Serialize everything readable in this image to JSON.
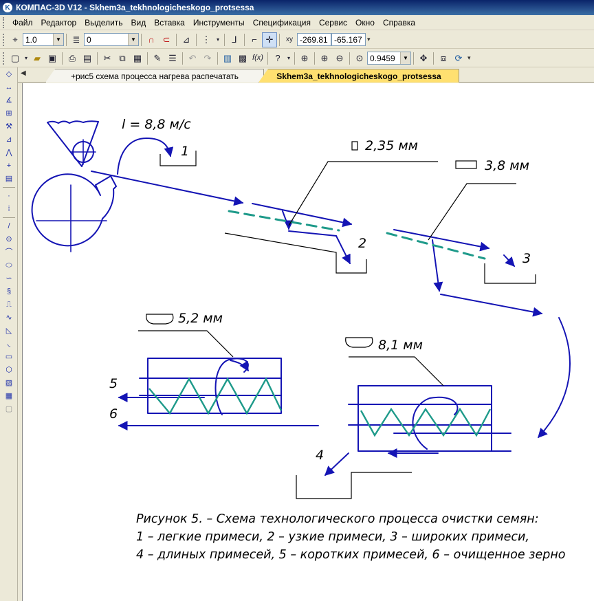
{
  "window": {
    "title": "КОМПАС-3D V12 - Skhem3a_tekhnologicheskogo_protsessa",
    "icon": "kompas-logo-icon"
  },
  "menu": {
    "items": [
      "Файл",
      "Редактор",
      "Выделить",
      "Вид",
      "Вставка",
      "Инструменты",
      "Спецификация",
      "Сервис",
      "Окно",
      "Справка"
    ]
  },
  "toolbar1": {
    "step": "1.0",
    "layer": "0",
    "coord_x": "-269.81",
    "coord_y": "-65.167"
  },
  "toolbar2": {
    "zoom": "0.9459",
    "fx_label": "f(x)"
  },
  "tabs": [
    {
      "label": "+рис5 схема процесса нагрева распечатать",
      "active": false
    },
    {
      "label": "Skhem3a_tekhnologicheskogo_protsessa",
      "active": true
    }
  ],
  "drawing": {
    "speed_label": "l = 8,8 м/с",
    "dim1": "2,35 мм",
    "dim2": "3,8 мм",
    "dim3": "5,2 мм",
    "dim4": "8,1 мм",
    "num1": "1",
    "num2": "2",
    "num3": "3",
    "num4": "4",
    "num5": "5",
    "num6": "6",
    "caption_line1": "Рисунок 5. – Схема  технологического процесса очистки семян:",
    "caption_line2": "1 – легкие примеси, 2 – узкие примеси, 3 – широких примеси,",
    "caption_line3": "4 – длиных примесей, 5 – коротких примесей, 6 – очищенное зерно",
    "colors": {
      "line": "#1414b4",
      "sieve": "#1e9a8a",
      "ink": "#000000"
    }
  }
}
